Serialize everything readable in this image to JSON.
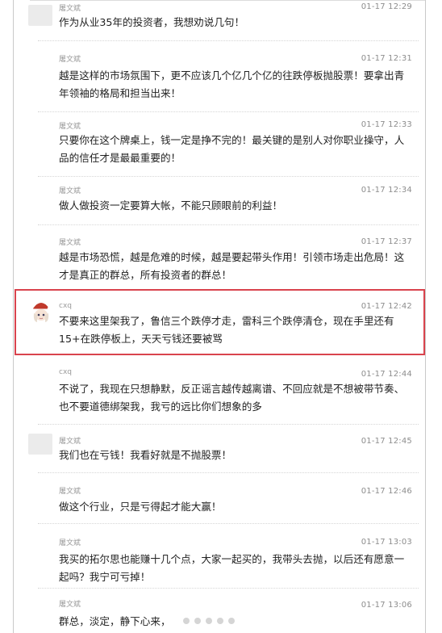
{
  "messages": [
    {
      "user": "屠文斌",
      "time": "01-17 12:29",
      "content": "作为从业35年的投资者，我想劝说几句！"
    },
    {
      "user": "屠文斌",
      "time": "01-17 12:31",
      "content": "越是这样的市场氛围下，更不应该几个亿几个亿的往跌停板抛股票！要拿出青年领袖的格局和担当出来！"
    },
    {
      "user": "屠文斌",
      "time": "01-17 12:33",
      "content": "只要你在这个牌桌上，钱一定是挣不完的！最关键的是别人对你职业操守，人品的信任才是最最重要的！"
    },
    {
      "user": "屠文斌",
      "time": "01-17 12:34",
      "content": "做人做投资一定要算大帐，不能只顾眼前的利益！"
    },
    {
      "user": "屠文斌",
      "time": "01-17 12:37",
      "content": "越是市场恐慌，越是危难的时候，越是要起带头作用！引领市场走出危局！这才是真正的群总，所有投资者的群总！"
    },
    {
      "user": "cxq",
      "time": "01-17 12:42",
      "content": "不要来这里架我了，鲁信三个跌停才走，雷科三个跌停清仓，现在手里还有15+在跌停板上，天天亏钱还要被骂"
    },
    {
      "user": "cxq",
      "time": "01-17 12:44",
      "content": "不说了，我现在只想静默，反正谣言越传越离谱、不回应就是不想被带节奏、也不要道德绑架我，我亏的远比你们想象的多"
    },
    {
      "user": "屠文斌",
      "time": "01-17 12:45",
      "content": "我们也在亏钱！我看好就是不抛股票！"
    },
    {
      "user": "屠文斌",
      "time": "01-17 12:46",
      "content": "做这个行业，只是亏得起才能大赢！"
    },
    {
      "user": "屠文斌",
      "time": "01-17 13:03",
      "content": "我买的拓尔思也能赚十几个点，大家一起买的，我带头去抛，以后还有愿意一起吗？我宁可亏掉！"
    },
    {
      "user": "屠文斌",
      "time": "01-17 13:06",
      "content": "群总，淡定，静下心来，"
    }
  ]
}
